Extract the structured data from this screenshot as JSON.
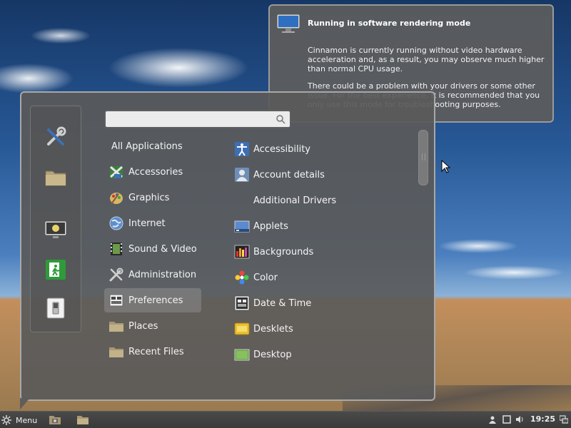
{
  "notification": {
    "title": "Running in software rendering mode",
    "body_1": "Cinnamon is currently running without video hardware acceleration and, as a result, you may observe much higher than normal CPU usage.",
    "body_2": "There could be a problem with your drivers or some other issue. For the best experience, it is recommended that you only use this mode for troubleshooting purposes.",
    "icon": "monitor-icon"
  },
  "menu": {
    "search": {
      "value": "",
      "placeholder": ""
    },
    "favorites": [
      {
        "name": "system-settings",
        "icon": "wrench-screwdriver-icon"
      },
      {
        "name": "files",
        "icon": "folder-icon"
      },
      {
        "name": "lock-screen",
        "icon": "lock-screen-icon"
      },
      {
        "name": "logout",
        "icon": "exit-icon"
      },
      {
        "name": "shutdown",
        "icon": "power-switch-icon"
      }
    ],
    "categories": [
      {
        "label": "All Applications",
        "icon": ""
      },
      {
        "label": "Accessories",
        "icon": "accessories-icon"
      },
      {
        "label": "Graphics",
        "icon": "graphics-palette-icon"
      },
      {
        "label": "Internet",
        "icon": "globe-icon"
      },
      {
        "label": "Sound & Video",
        "icon": "film-music-icon"
      },
      {
        "label": "Administration",
        "icon": "tools-icon"
      },
      {
        "label": "Preferences",
        "icon": "preferences-icon",
        "selected": true
      },
      {
        "label": "Places",
        "icon": "folder-icon"
      },
      {
        "label": "Recent Files",
        "icon": "folder-icon"
      }
    ],
    "apps": [
      {
        "label": "Accessibility",
        "icon": "accessibility-icon"
      },
      {
        "label": "Account details",
        "icon": "account-icon"
      },
      {
        "label": "Additional Drivers",
        "icon": ""
      },
      {
        "label": "Applets",
        "icon": "applets-icon"
      },
      {
        "label": "Backgrounds",
        "icon": "backgrounds-icon"
      },
      {
        "label": "Color",
        "icon": "color-icon"
      },
      {
        "label": "Date & Time",
        "icon": "date-time-icon"
      },
      {
        "label": "Desklets",
        "icon": "desklets-icon"
      },
      {
        "label": "Desktop",
        "icon": "desktop-icon"
      }
    ]
  },
  "panel": {
    "menu_label": "Menu",
    "clock": "19:25",
    "launchers": [
      "screenshot-icon",
      "folder-icon"
    ],
    "tray": [
      "user-icon",
      "window-icon",
      "volume-icon",
      "network-icon"
    ]
  },
  "colors": {
    "menu_bg": "#5a5a5a",
    "selected_bg": "#8c8c8c",
    "panel_bg": "#3e3e3e"
  }
}
